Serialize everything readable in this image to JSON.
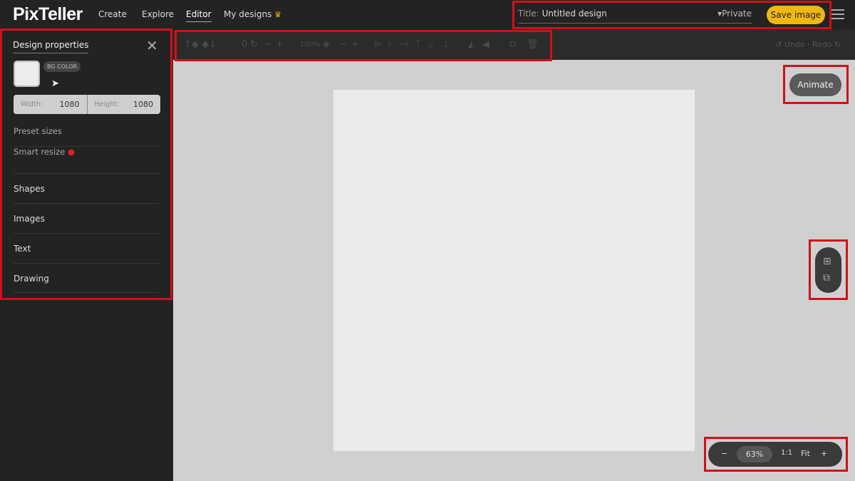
{
  "header": {
    "logo": "PixTeller",
    "nav": [
      "Create",
      "Explore",
      "Editor",
      "My designs"
    ],
    "active_nav": "Editor",
    "title_label": "Title:",
    "title_value": "Untitled design",
    "privacy": "Private",
    "save_label": "Save image"
  },
  "toolbar": {
    "rotation": "0",
    "opacity": "100%",
    "undo": "Undo",
    "redo": "Redo"
  },
  "sidebar": {
    "title": "Design properties",
    "bg_color_label": "BG COLOR",
    "width_label": "Width:",
    "width_value": "1080",
    "height_label": "Height:",
    "height_value": "1080",
    "preset_sizes": "Preset sizes",
    "smart_resize": "Smart resize",
    "sections": [
      "Shapes",
      "Images",
      "Text",
      "Drawing"
    ]
  },
  "canvas": {
    "animate_label": "Animate"
  },
  "zoom": {
    "value": "63%",
    "one_to_one": "1:1",
    "fit": "Fit"
  },
  "colors": {
    "accent": "#f0b80f",
    "highlight": "#d0101a"
  }
}
